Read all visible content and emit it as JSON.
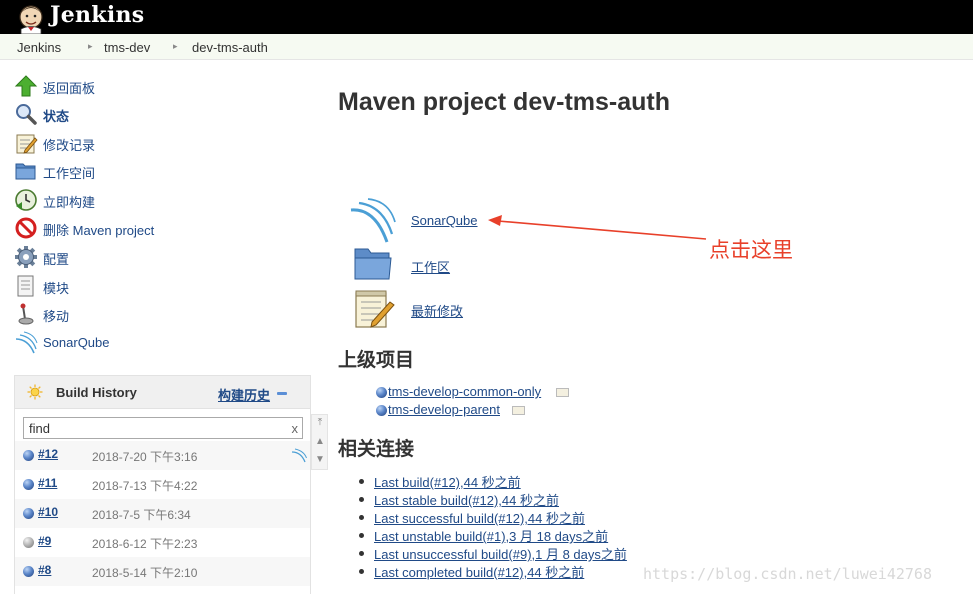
{
  "header": {
    "brand": "Jenkins"
  },
  "breadcrumb": [
    {
      "label": "Jenkins"
    },
    {
      "label": "tms-dev"
    },
    {
      "label": "dev-tms-auth"
    }
  ],
  "sidebar": {
    "items": [
      {
        "label": "返回面板",
        "icon": "up-arrow-icon"
      },
      {
        "label": "状态",
        "icon": "magnifier-icon"
      },
      {
        "label": "修改记录",
        "icon": "notepad-icon"
      },
      {
        "label": "工作空间",
        "icon": "folder-icon"
      },
      {
        "label": "立即构建",
        "icon": "clock-build-icon"
      },
      {
        "label": "删除 Maven project",
        "icon": "no-entry-icon"
      },
      {
        "label": "配置",
        "icon": "gear-icon"
      },
      {
        "label": "模块",
        "icon": "document-icon"
      },
      {
        "label": "移动",
        "icon": "joystick-icon"
      },
      {
        "label": "SonarQube",
        "icon": "sonarqube-icon"
      }
    ]
  },
  "build_history": {
    "title": "Build History",
    "trend_link": "构建历史",
    "search": {
      "value": "find",
      "clear": "x"
    },
    "builds": [
      {
        "number": "#12",
        "date": "2018-7-20 下午3:16",
        "status": "blue"
      },
      {
        "number": "#11",
        "date": "2018-7-13 下午4:22",
        "status": "blue"
      },
      {
        "number": "#10",
        "date": "2018-7-5 下午6:34",
        "status": "blue"
      },
      {
        "number": "#9",
        "date": "2018-6-12 下午2:23",
        "status": "grey"
      },
      {
        "number": "#8",
        "date": "2018-5-14 下午2:10",
        "status": "blue"
      }
    ]
  },
  "main": {
    "title": "Maven project dev-tms-auth",
    "links": [
      {
        "label": "SonarQube",
        "icon": "sonarqube-icon"
      },
      {
        "label": "工作区",
        "icon": "folder-icon"
      },
      {
        "label": "最新修改",
        "icon": "notepad-icon"
      }
    ],
    "upstream_title": "上级项目",
    "upstream": [
      {
        "label": "tms-develop-common-only"
      },
      {
        "label": "tms-develop-parent"
      }
    ],
    "related_title": "相关连接",
    "related": [
      {
        "label": "Last build(#12),44 秒之前"
      },
      {
        "label": "Last stable build(#12),44 秒之前"
      },
      {
        "label": "Last successful build(#12),44 秒之前"
      },
      {
        "label": "Last unstable build(#1),3 月 18 days之前"
      },
      {
        "label": "Last unsuccessful build(#9),1 月 8 days之前"
      },
      {
        "label": "Last completed build(#12),44 秒之前"
      }
    ]
  },
  "annotation": {
    "text": "点击这里"
  },
  "watermark": {
    "text": "https://blog.csdn.net/luwei42768"
  },
  "colors": {
    "header": "#000000",
    "link": "#204a87",
    "annotation": "#e8402a"
  }
}
